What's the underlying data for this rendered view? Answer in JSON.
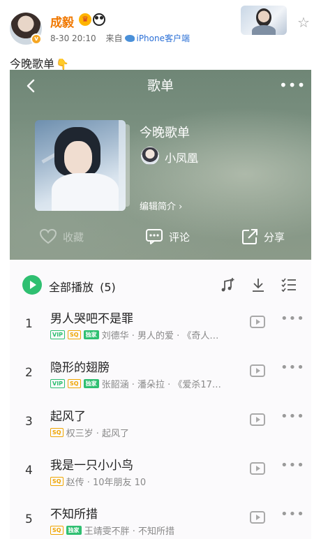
{
  "post": {
    "username": "成毅",
    "verified_mark": "v",
    "crown_badge": "♛",
    "time": "8-30 20:10",
    "source_prefix": "来自",
    "source_app": "iPhone客户端",
    "text": "今晚歌单",
    "emoji": "👇",
    "icons": [
      "avatar",
      "verified-badge",
      "crown-badge",
      "panda-badge",
      "weibo-bird-icon",
      "fan-card",
      "star-icon"
    ]
  },
  "playlist": {
    "nav_title": "歌单",
    "back_icon": "chevron-left-icon",
    "more_icon": "ellipsis-icon",
    "name": "今晚歌单",
    "creator": "小凤凰",
    "edit_intro": "编辑简介 ›",
    "actions": [
      {
        "label": "收藏",
        "icon": "heart-icon",
        "enabled": false
      },
      {
        "label": "评论",
        "icon": "comment-icon",
        "enabled": true
      },
      {
        "label": "分享",
        "icon": "share-icon",
        "enabled": true
      }
    ],
    "play_all_label": "全部播放",
    "count": "(5)",
    "tools": [
      "music-note-add-icon",
      "download-icon",
      "multi-select-icon"
    ],
    "accent_color": "#2fbf71",
    "songs": [
      {
        "index": "1",
        "title": "男人哭吧不是罪",
        "tags": [
          "VIP",
          "SQ",
          "独家"
        ],
        "meta": "刘德华 · 男人的爱 · 《奇人…"
      },
      {
        "index": "2",
        "title": "隐形的翅膀",
        "tags": [
          "VIP",
          "SQ",
          "独家"
        ],
        "meta": "张韶涵 · 潘朵拉 · 《爱杀17…"
      },
      {
        "index": "3",
        "title": "起风了",
        "tags": [
          "SQ"
        ],
        "meta": "权三岁 · 起风了"
      },
      {
        "index": "4",
        "title": "我是一只小小鸟",
        "tags": [
          "SQ"
        ],
        "meta": "赵传 · 10年朋友 10"
      },
      {
        "index": "5",
        "title": "不知所措",
        "tags": [
          "SQ",
          "独家"
        ],
        "meta": "王靖雯不胖 · 不知所措"
      }
    ]
  }
}
